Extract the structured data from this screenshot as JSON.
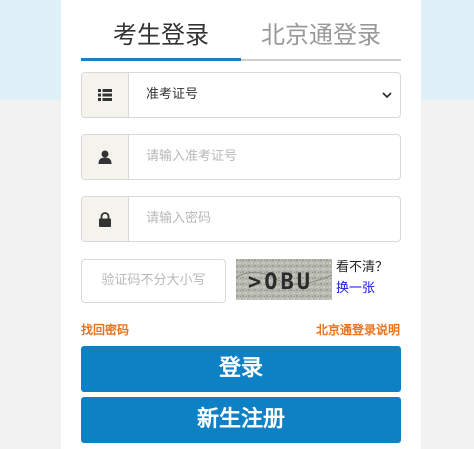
{
  "tabs": {
    "active_label": "考生登录",
    "inactive_label": "北京通登录"
  },
  "form": {
    "id_type_select": {
      "value": "准考证号",
      "icon": "list-icon"
    },
    "id_field": {
      "placeholder": "请输入准考证号",
      "icon": "user-icon"
    },
    "password_field": {
      "placeholder": "请输入密码",
      "icon": "lock-icon"
    },
    "captcha": {
      "placeholder": "验证码不分大小写",
      "image_text": ">OBU",
      "help_label": "看不清？",
      "refresh_label": "换一张"
    }
  },
  "links": {
    "forgot_password": "找回密码",
    "bjt_help": "北京通登录说明"
  },
  "buttons": {
    "login": "登录",
    "register": "新生注册"
  },
  "colors": {
    "accent": "#0e81c4",
    "link": "#e8741f",
    "tab_underline": "#1a7fc4"
  }
}
